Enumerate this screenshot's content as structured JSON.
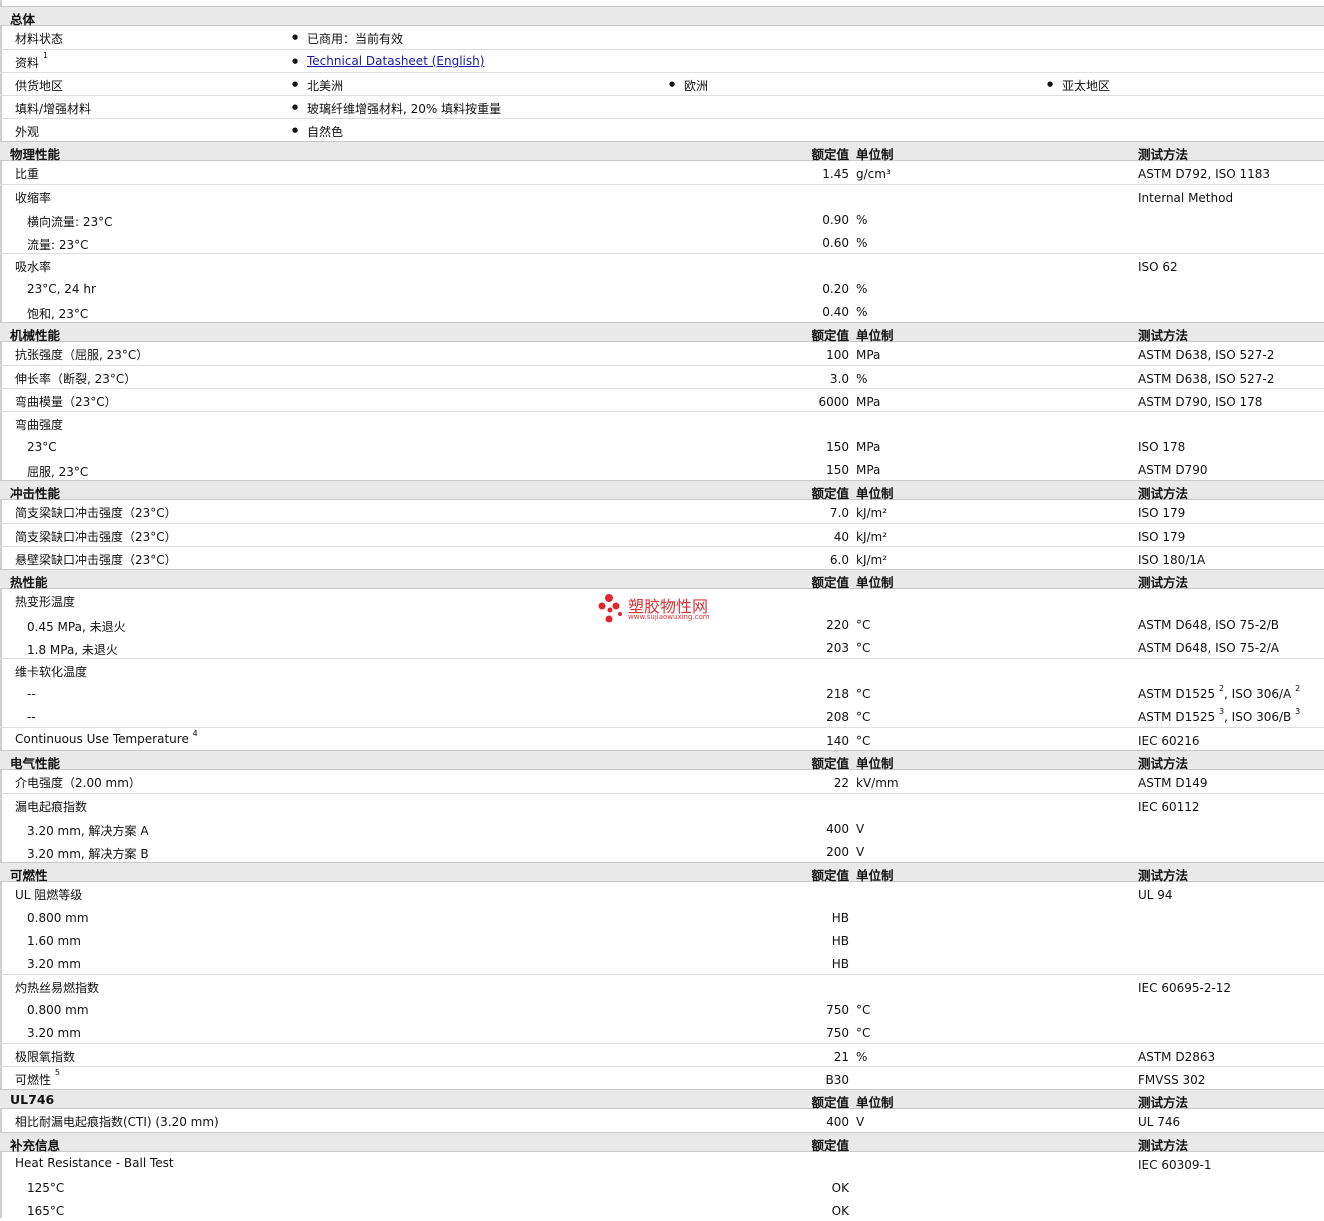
{
  "general": {
    "title": "总体",
    "rows": [
      {
        "label": "材料状态",
        "items": [
          "已商用：当前有效"
        ]
      },
      {
        "label": "资料",
        "sup": "1",
        "items": [
          "Technical Datasheet (English)"
        ],
        "link": true
      },
      {
        "label": "供货地区",
        "items": [
          "北美洲",
          "欧洲",
          "亚太地区"
        ]
      },
      {
        "label": "填料/增强材料",
        "items": [
          "玻璃纤维增强材料, 20% 填料按重量"
        ]
      },
      {
        "label": "外观",
        "items": [
          "自然色"
        ]
      }
    ]
  },
  "headers": {
    "value": "额定值",
    "unit": "单位制",
    "method": "测试方法"
  },
  "sections": [
    {
      "title": "物理性能",
      "rows": [
        {
          "label": "比重",
          "value": "1.45",
          "unit": "g/cm³",
          "method": "ASTM D792, ISO 1183"
        },
        {
          "label": "收缩率",
          "method": "Internal Method"
        },
        {
          "label": "横向流量: 23°C",
          "sub": true,
          "value": "0.90",
          "unit": "%"
        },
        {
          "label": "流量: 23°C",
          "sub": true,
          "value": "0.60",
          "unit": "%"
        },
        {
          "label": "吸水率",
          "method": "ISO 62"
        },
        {
          "label": "23°C, 24 hr",
          "sub": true,
          "value": "0.20",
          "unit": "%"
        },
        {
          "label": "饱和, 23°C",
          "sub": true,
          "value": "0.40",
          "unit": "%"
        }
      ]
    },
    {
      "title": "机械性能",
      "rows": [
        {
          "label": "抗张强度（屈服, 23°C）",
          "value": "100",
          "unit": "MPa",
          "method": "ASTM D638, ISO 527-2"
        },
        {
          "label": "伸长率（断裂, 23°C）",
          "value": "3.0",
          "unit": "%",
          "method": "ASTM D638, ISO 527-2"
        },
        {
          "label": "弯曲模量（23°C）",
          "value": "6000",
          "unit": "MPa",
          "method": "ASTM D790, ISO 178"
        },
        {
          "label": "弯曲强度"
        },
        {
          "label": "23°C",
          "sub": true,
          "value": "150",
          "unit": "MPa",
          "method": "ISO 178"
        },
        {
          "label": "屈服, 23°C",
          "sub": true,
          "value": "150",
          "unit": "MPa",
          "method": "ASTM D790"
        }
      ]
    },
    {
      "title": "冲击性能",
      "rows": [
        {
          "label": "简支梁缺口冲击强度（23°C）",
          "value": "7.0",
          "unit": "kJ/m²",
          "method": "ISO 179"
        },
        {
          "label": "简支梁缺口冲击强度（23°C）",
          "value": "40",
          "unit": "kJ/m²",
          "method": "ISO 179"
        },
        {
          "label": "悬壁梁缺口冲击强度（23°C）",
          "value": "6.0",
          "unit": "kJ/m²",
          "method": "ISO 180/1A"
        }
      ]
    },
    {
      "title": "热性能",
      "rows": [
        {
          "label": "热变形温度"
        },
        {
          "label": "0.45 MPa, 未退火",
          "sub": true,
          "value": "220",
          "unit": "°C",
          "method": "ASTM D648, ISO 75-2/B"
        },
        {
          "label": "1.8 MPa, 未退火",
          "sub": true,
          "value": "203",
          "unit": "°C",
          "method": "ASTM D648, ISO 75-2/A"
        },
        {
          "label": "维卡软化温度"
        },
        {
          "label": "--",
          "sub": true,
          "value": "218",
          "unit": "°C",
          "method": "ASTM D1525",
          "sup1": "2",
          "method2": ", ISO 306/A",
          "sup2": "2"
        },
        {
          "label": "--",
          "sub": true,
          "value": "208",
          "unit": "°C",
          "method": "ASTM D1525",
          "sup1": "3",
          "method2": ", ISO 306/B",
          "sup2": "3"
        },
        {
          "label": "Continuous Use Temperature",
          "lsup": "4",
          "value": "140",
          "unit": "°C",
          "method": "IEC 60216"
        }
      ]
    },
    {
      "title": "电气性能",
      "rows": [
        {
          "label": "介电强度（2.00 mm）",
          "value": "22",
          "unit": "kV/mm",
          "method": "ASTM D149"
        },
        {
          "label": "漏电起痕指数",
          "method": "IEC 60112"
        },
        {
          "label": "3.20 mm, 解决方案  A",
          "sub": true,
          "value": "400",
          "unit": "V"
        },
        {
          "label": "3.20 mm, 解决方案  B",
          "sub": true,
          "value": "200",
          "unit": "V"
        }
      ]
    },
    {
      "title": "可燃性",
      "rows": [
        {
          "label": "UL 阻燃等级",
          "method": "UL 94"
        },
        {
          "label": "0.800 mm",
          "sub": true,
          "value": "HB"
        },
        {
          "label": "1.60 mm",
          "sub": true,
          "value": "HB"
        },
        {
          "label": "3.20 mm",
          "sub": true,
          "value": "HB"
        },
        {
          "label": "灼热丝易燃指数",
          "method": "IEC 60695-2-12"
        },
        {
          "label": "0.800 mm",
          "sub": true,
          "value": "750",
          "unit": "°C"
        },
        {
          "label": "3.20 mm",
          "sub": true,
          "value": "750",
          "unit": "°C"
        },
        {
          "label": "极限氧指数",
          "value": "21",
          "unit": "%",
          "method": "ASTM D2863"
        },
        {
          "label": "可燃性",
          "lsup": "5",
          "value": "B30",
          "method": "FMVSS 302"
        }
      ]
    },
    {
      "title": "UL746",
      "rows": [
        {
          "label": "相比耐漏电起痕指数(CTI) (3.20 mm)",
          "value": "400",
          "unit": "V",
          "method": "UL 746"
        }
      ]
    },
    {
      "title": "补充信息",
      "nounit": true,
      "rows": [
        {
          "label": "Heat Resistance - Ball Test",
          "method": "IEC 60309-1"
        },
        {
          "label": "125°C",
          "sub": true,
          "value": "OK"
        },
        {
          "label": "165°C",
          "sub": true,
          "value": "OK"
        }
      ]
    }
  ],
  "watermark": {
    "name": "塑胶物性网",
    "url": "www.sujiaowuxing.com",
    "color": "#d8323a"
  }
}
